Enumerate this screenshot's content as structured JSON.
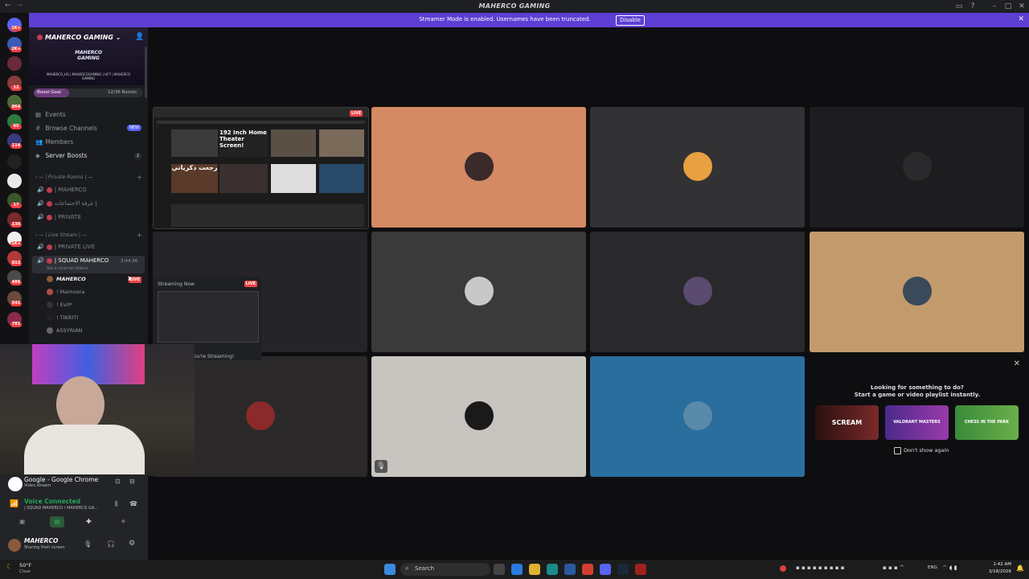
{
  "titlebar": {
    "title": "MAHERCO GAMING"
  },
  "banner": {
    "message": "Streamer Mode is enabled. Usernames have been truncated.",
    "disable_label": "Disable"
  },
  "rail": {
    "badges": [
      "1K+",
      "2K+",
      "12",
      "864",
      "95",
      "114",
      "",
      "17",
      "130",
      "1K+",
      "813",
      "486",
      "541",
      "781"
    ]
  },
  "sidebar": {
    "server_name": "MAHERCO GAMING",
    "banner_title": "MAHERCO GAMING",
    "banner_sub": "MAHERCO_HS | MAHERCOGAMING | HF7 | MAHERCO GAMING",
    "boost_goal_label": "Boost Goal",
    "boost_count": "12/36 Boosts",
    "nav": [
      {
        "label": "Events",
        "badge": ""
      },
      {
        "label": "Browse Channels",
        "badge": "NEW"
      },
      {
        "label": "Members",
        "badge": ""
      },
      {
        "label": "Server Boosts",
        "badge": "2"
      }
    ],
    "cat_private": "— | Private Rooms | —",
    "private_channels": [
      "| MAHERCO",
      "غرفة الاجتماعات |",
      "| PRIVATE"
    ],
    "cat_live": "— | Live Stream | —",
    "live_channels": [
      "| PRIVATE LIVE",
      "| SQUAD MAHERCO"
    ],
    "active_timer": "3:44:36",
    "channel_status": "Set a channel status",
    "users": [
      {
        "name": "MAHERCO",
        "live": "LIVE"
      },
      {
        "name": "! Mamoora",
        "live": ""
      },
      {
        "name": "! Evil*",
        "live": ""
      },
      {
        "name": "! TIKRITI",
        "live": ""
      },
      {
        "name": "ASSYRIAN",
        "live": ""
      },
      {
        "name": "",
        "live": ""
      }
    ]
  },
  "stream_popup": {
    "heading": "Streaming Now",
    "live": "LIVE",
    "footer": "You're Streaming!"
  },
  "stream_tile": {
    "live": "LIVE",
    "thumb_texts": [
      "192 Inch Home Theater Screen!",
      "رجعت ذكرياتي"
    ]
  },
  "voice_panel": {
    "app_title": "Google - Google Chrome",
    "app_sub": "Video stream",
    "voice_status": "Voice Connected",
    "voice_channel": "| SQUAD MAHERCO / MAHERCO GA...",
    "username": "MAHERCO",
    "user_status": "Sharing their screen"
  },
  "activity": {
    "line1": "Looking for something to do?",
    "line2": "Start a game or video playlist instantly.",
    "games": [
      "SCREAM",
      "VALORANT MASTERS",
      "CHESS IN THE PARK"
    ],
    "dont_show": "Don't show again"
  },
  "taskbar": {
    "weather_temp": "50°F",
    "weather_desc": "Clear",
    "search": "Search",
    "lang": "ENG",
    "time": "1:42 AM",
    "date": "3/18/2026"
  },
  "colors": {
    "accent": "#5d3fd3",
    "live": "#ed4245",
    "orange_tile": "#d48a62",
    "tan_tile": "#c39a6c",
    "blue_tile": "#2a6e9e"
  }
}
